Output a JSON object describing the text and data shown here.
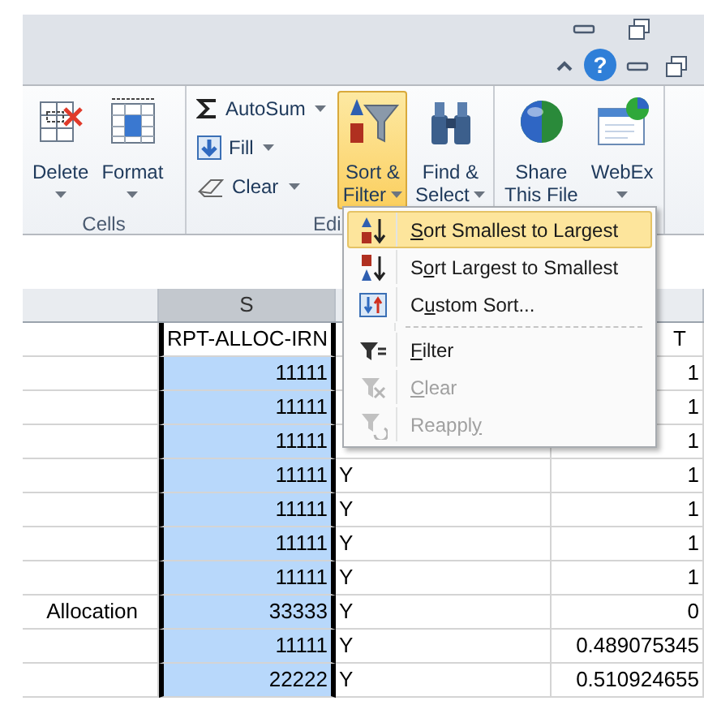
{
  "window_controls": {
    "help": "?"
  },
  "ribbon": {
    "groups": [
      {
        "label": "Cells",
        "buttons": [
          {
            "kind": "large",
            "lines": [
              "Delete"
            ],
            "dropdown": true,
            "pressed": false
          },
          {
            "kind": "large",
            "lines": [
              "Format"
            ],
            "dropdown": true,
            "pressed": false
          }
        ]
      },
      {
        "label": "Edi",
        "buttons": [
          {
            "kind": "small",
            "lines": [
              "AutoSum"
            ],
            "dropdown": true,
            "pressed": false
          },
          {
            "kind": "small",
            "lines": [
              "Fill"
            ],
            "dropdown": true,
            "pressed": false
          },
          {
            "kind": "small",
            "lines": [
              "Clear"
            ],
            "dropdown": true,
            "pressed": false
          },
          {
            "kind": "large",
            "lines": [
              "Sort &",
              "Filter"
            ],
            "dropdown": true,
            "pressed": true
          },
          {
            "kind": "large",
            "lines": [
              "Find &",
              "Select"
            ],
            "dropdown": true,
            "pressed": false
          }
        ]
      },
      {
        "buttons": [
          {
            "kind": "large",
            "lines": [
              "Share",
              "This File"
            ],
            "dropdown": false,
            "pressed": false
          },
          {
            "kind": "large",
            "lines": [
              "WebEx"
            ],
            "dropdown": true,
            "pressed": false
          }
        ]
      }
    ]
  },
  "sheet": {
    "columns": [
      {
        "selected": false
      },
      {
        "label": "S",
        "selected": true
      },
      {
        "selected": false
      },
      {
        "selected": false
      }
    ],
    "rows": [
      {
        "s": "RPT-ALLOC-IRN",
        "u": "T"
      },
      {
        "s": "11111",
        "u": "1"
      },
      {
        "s": "11111",
        "u": "1"
      },
      {
        "s": "11111",
        "u": "1"
      },
      {
        "s": "11111",
        "t": "Y",
        "u": "1"
      },
      {
        "s": "11111",
        "t": "Y",
        "u": "1"
      },
      {
        "s": "11111",
        "t": "Y",
        "u": "1"
      },
      {
        "s": "11111",
        "t": "Y",
        "u": "1"
      },
      {
        "r": "Allocation",
        "s": "33333",
        "t": "Y",
        "u": "0"
      },
      {
        "s": "11111",
        "t": "Y",
        "u": "0.489075345"
      },
      {
        "s": "22222",
        "t": "Y",
        "u": "0.510924655"
      }
    ]
  },
  "menu": {
    "items": [
      {
        "kind": "item",
        "label": "Sort Smallest to Largest",
        "selected": true,
        "disabled": false
      },
      {
        "kind": "item",
        "label": "Sort Largest to Smallest",
        "selected": false,
        "disabled": false
      },
      {
        "kind": "item",
        "label": "Custom Sort...",
        "selected": false,
        "disabled": false
      },
      {
        "kind": "separator"
      },
      {
        "kind": "item",
        "label": "Filter",
        "selected": false,
        "disabled": false
      },
      {
        "kind": "item",
        "label": "Clear",
        "selected": false,
        "disabled": true
      },
      {
        "kind": "item",
        "label": "Reapply",
        "selected": false,
        "disabled": true
      }
    ]
  }
}
